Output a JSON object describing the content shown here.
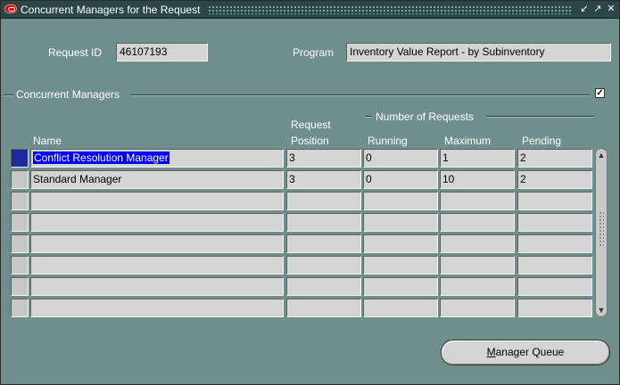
{
  "window": {
    "title": "Concurrent Managers for the Request"
  },
  "titlebar_buttons": [
    "restore-down-icon",
    "maximize-icon",
    "close-icon"
  ],
  "request": {
    "id_label": "Request ID",
    "id_value": "46107193",
    "program_label": "Program",
    "program_value": "Inventory Value Report - by Subinventory"
  },
  "section": {
    "title": "Concurrent Managers",
    "checked": true
  },
  "table": {
    "group_header": "Number of Requests",
    "headers": {
      "name": "Name",
      "position_line1": "Request",
      "position_line2": "Position",
      "running": "Running",
      "maximum": "Maximum",
      "pending": "Pending"
    },
    "rows": [
      {
        "name": "Conflict Resolution Manager",
        "position": "3",
        "running": "0",
        "maximum": "1",
        "pending": "2"
      },
      {
        "name": "Standard Manager",
        "position": "3",
        "running": "0",
        "maximum": "10",
        "pending": "2"
      },
      {
        "name": "",
        "position": "",
        "running": "",
        "maximum": "",
        "pending": ""
      },
      {
        "name": "",
        "position": "",
        "running": "",
        "maximum": "",
        "pending": ""
      },
      {
        "name": "",
        "position": "",
        "running": "",
        "maximum": "",
        "pending": ""
      },
      {
        "name": "",
        "position": "",
        "running": "",
        "maximum": "",
        "pending": ""
      },
      {
        "name": "",
        "position": "",
        "running": "",
        "maximum": "",
        "pending": ""
      },
      {
        "name": "",
        "position": "",
        "running": "",
        "maximum": "",
        "pending": ""
      }
    ]
  },
  "buttons": {
    "manager_queue_prefix": "",
    "manager_queue_mnemonic": "M",
    "manager_queue_rest": "anager Queue"
  }
}
